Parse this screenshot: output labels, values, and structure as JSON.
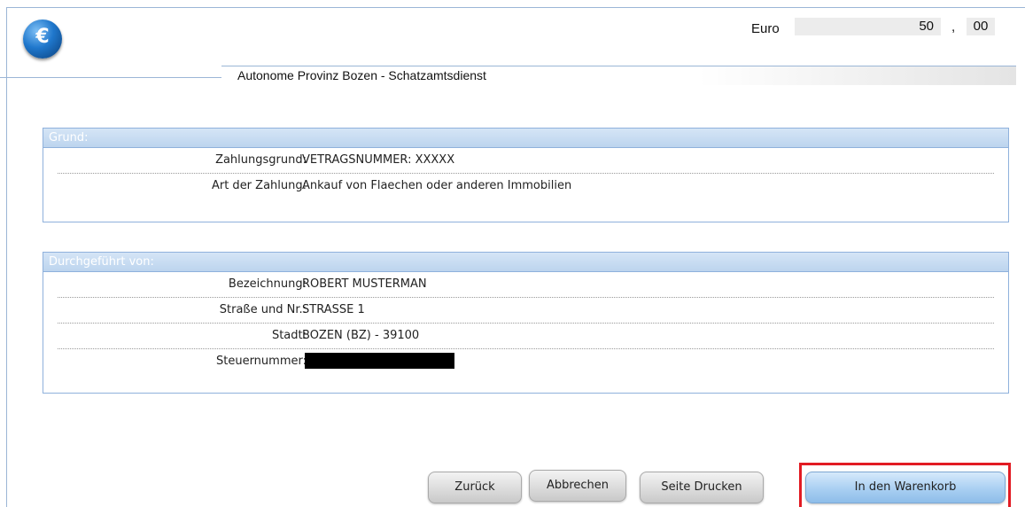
{
  "header": {
    "currency_label": "Euro",
    "amount_integer": "50",
    "amount_separator": ",",
    "amount_decimal": "00",
    "provider": "Autonome Provinz Bozen - Schatzamtsdienst",
    "logo_symbol": "€"
  },
  "grund": {
    "title": "Grund:",
    "rows": [
      {
        "label": "Zahlungsgrund:",
        "value": "VETRAGSNUMMER: XXXXX"
      },
      {
        "label": "Art der Zahlung:",
        "value": "Ankauf von Flaechen oder anderen Immobilien"
      }
    ]
  },
  "durchgefuehrt": {
    "title": "Durchgeführt von:",
    "rows": [
      {
        "label": "Bezeichnung:",
        "value": "ROBERT MUSTERMAN"
      },
      {
        "label": "Straße und Nr.:",
        "value": "STRASSE 1"
      },
      {
        "label": "Stadt:",
        "value": "BOZEN (BZ) - 39100"
      },
      {
        "label": "Steuernummer:",
        "value": ""
      }
    ]
  },
  "buttons": {
    "back": "Zurück",
    "cancel": "Abbrechen",
    "print": "Seite Drucken",
    "add_to_cart": "In den Warenkorb"
  },
  "colors": {
    "highlight": "#e21b23",
    "panel_border": "#8fb1dc",
    "primary_button": "#a9cff2"
  },
  "icons": {
    "logo": "euro-coin-icon"
  }
}
